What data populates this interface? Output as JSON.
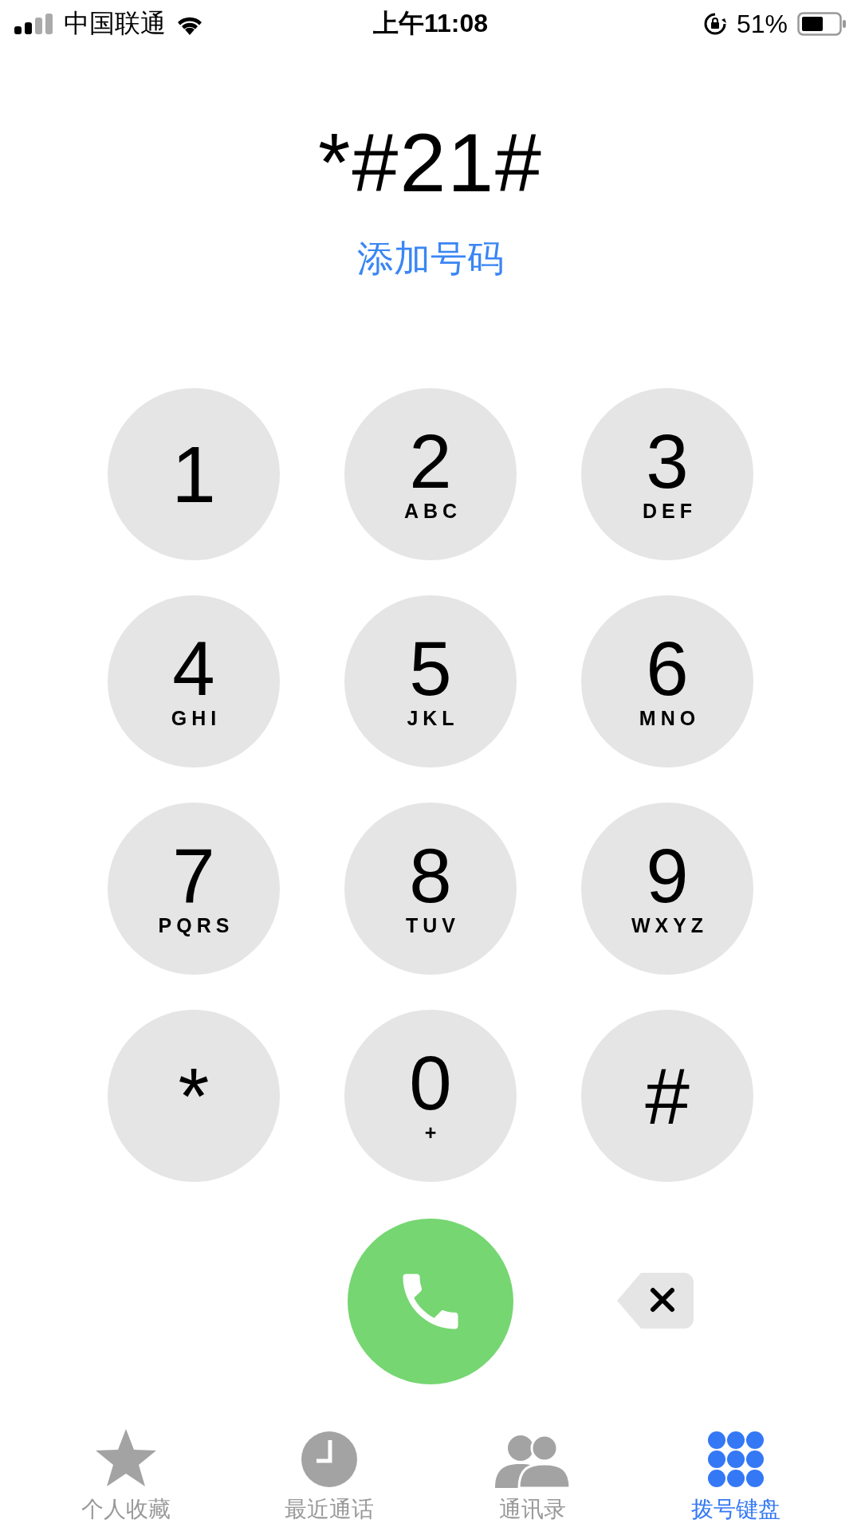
{
  "status_bar": {
    "carrier": "中国联通",
    "time": "上午11:08",
    "battery": "51%"
  },
  "display": {
    "number": "*#21#",
    "add_number": "添加号码"
  },
  "keys": [
    {
      "digit": "1"
    },
    {
      "digit": "2",
      "letters": "ABC"
    },
    {
      "digit": "3",
      "letters": "DEF"
    },
    {
      "digit": "4",
      "letters": "GHI"
    },
    {
      "digit": "5",
      "letters": "JKL"
    },
    {
      "digit": "6",
      "letters": "MNO"
    },
    {
      "digit": "7",
      "letters": "PQRS"
    },
    {
      "digit": "8",
      "letters": "TUV"
    },
    {
      "digit": "9",
      "letters": "WXYZ"
    },
    {
      "digit": "*"
    },
    {
      "digit": "0",
      "letters": "+"
    },
    {
      "digit": "#"
    }
  ],
  "tabs": [
    {
      "label": "个人收藏",
      "selected": false
    },
    {
      "label": "最近通话",
      "selected": false
    },
    {
      "label": "通讯录",
      "selected": false
    },
    {
      "label": "拨号键盘",
      "selected": true
    }
  ]
}
